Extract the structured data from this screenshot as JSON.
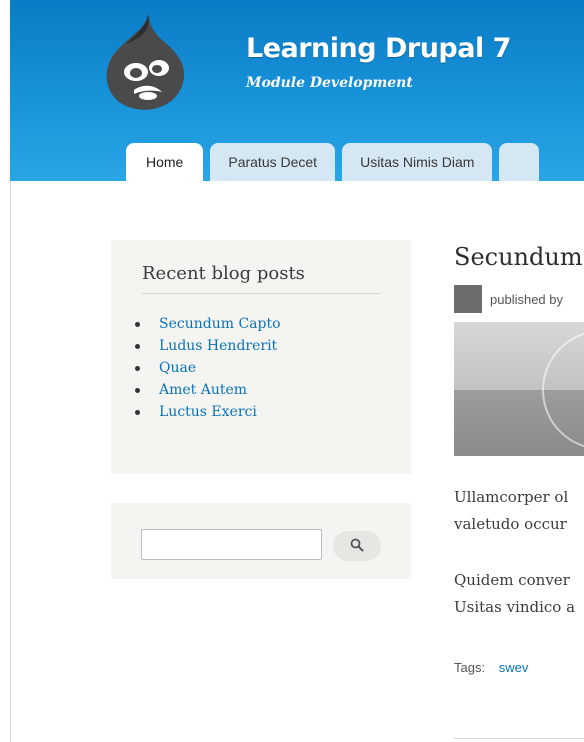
{
  "header": {
    "site_name": "Learning Drupal 7",
    "slogan": "Module Development",
    "logo_icon": "drupal-drop-icon"
  },
  "tabs": [
    {
      "label": "Home",
      "active": true
    },
    {
      "label": "Paratus Decet",
      "active": false
    },
    {
      "label": "Usitas Nimis Diam",
      "active": false
    }
  ],
  "recent_posts": {
    "title": "Recent blog posts",
    "items": [
      "Secundum Capto",
      "Ludus Hendrerit",
      "Quae",
      "Amet Autem",
      "Luctus Exerci"
    ]
  },
  "search": {
    "value": "",
    "button_icon": "search-icon"
  },
  "node": {
    "title": "Secundum",
    "submitted": "published by",
    "paragraphs": [
      [
        "Ullamcorper ol",
        "valetudo occur"
      ],
      [
        "Quidem conver",
        "Usitas vindico a"
      ]
    ],
    "tags_label": "Tags:",
    "tags": [
      "swev"
    ]
  },
  "colors": {
    "header_blue": "#1893d9",
    "link": "#0a73b8",
    "tab_inactive": "#d4e7f3",
    "sidebar_bg": "#f4f4f0"
  }
}
